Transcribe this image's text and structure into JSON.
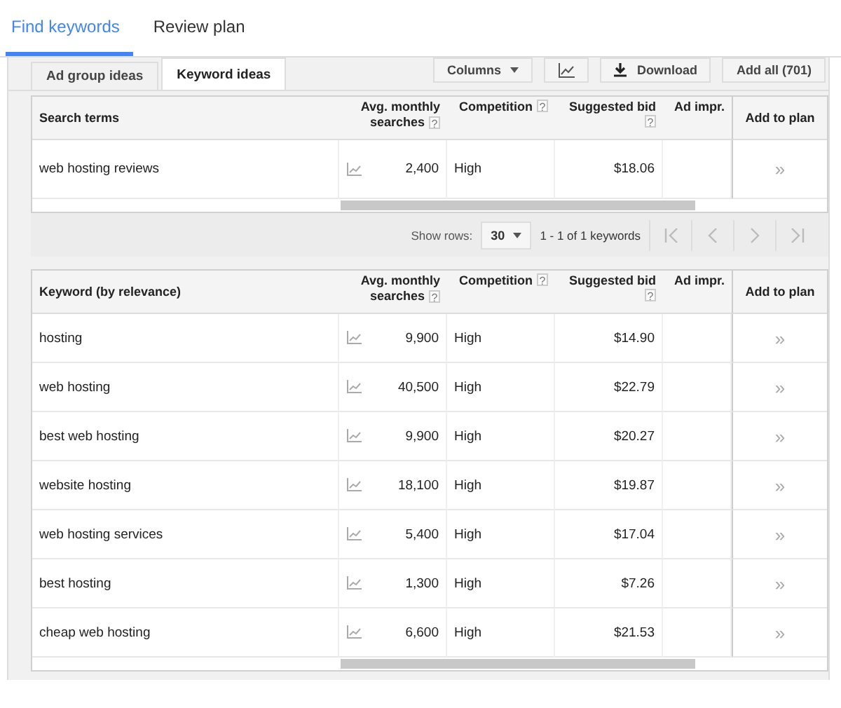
{
  "top_tabs": [
    {
      "label": "Find keywords",
      "selected": true
    },
    {
      "label": "Review plan",
      "selected": false
    }
  ],
  "sub_tabs": [
    {
      "label": "Ad group ideas",
      "selected": false
    },
    {
      "label": "Keyword ideas",
      "selected": true
    }
  ],
  "toolbar": {
    "columns_button": "Columns",
    "download_button": "Download",
    "add_all_button": "Add all (701)"
  },
  "search_terms_table": {
    "columns": [
      {
        "label": "Search terms"
      },
      {
        "label": "Avg. monthly searches",
        "help": "?"
      },
      {
        "label": "Competition",
        "help": "?"
      },
      {
        "label": "Suggested bid",
        "help": "?"
      },
      {
        "label": "Ad impr."
      },
      {
        "label": "Add to plan"
      }
    ],
    "rows": [
      {
        "term": "web hosting reviews",
        "searches": "2,400",
        "competition": "High",
        "bid": "$18.06",
        "add": "»"
      }
    ]
  },
  "pager": {
    "show_rows_label": "Show rows:",
    "rows_per_page": "30",
    "range": "1 - 1 of 1 keywords"
  },
  "keyword_table": {
    "columns": [
      {
        "label": "Keyword (by relevance)"
      },
      {
        "label": "Avg. monthly searches",
        "help": "?"
      },
      {
        "label": "Competition",
        "help": "?"
      },
      {
        "label": "Suggested bid",
        "help": "?"
      },
      {
        "label": "Ad impr."
      },
      {
        "label": "Add to plan"
      }
    ],
    "rows": [
      {
        "term": "hosting",
        "searches": "9,900",
        "competition": "High",
        "bid": "$14.90",
        "add": "»"
      },
      {
        "term": "web hosting",
        "searches": "40,500",
        "competition": "High",
        "bid": "$22.79",
        "add": "»"
      },
      {
        "term": "best web hosting",
        "searches": "9,900",
        "competition": "High",
        "bid": "$20.27",
        "add": "»"
      },
      {
        "term": "website hosting",
        "searches": "18,100",
        "competition": "High",
        "bid": "$19.87",
        "add": "»"
      },
      {
        "term": "web hosting services",
        "searches": "5,400",
        "competition": "High",
        "bid": "$17.04",
        "add": "»"
      },
      {
        "term": "best hosting",
        "searches": "1,300",
        "competition": "High",
        "bid": "$7.26",
        "add": "»"
      },
      {
        "term": "cheap web hosting",
        "searches": "6,600",
        "competition": "High",
        "bid": "$21.53",
        "add": "»"
      }
    ]
  }
}
